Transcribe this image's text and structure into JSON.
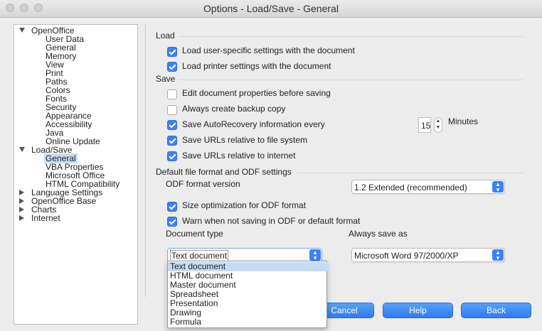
{
  "window": {
    "title": "Options - Load/Save - General"
  },
  "tree": {
    "items": [
      {
        "label": "OpenOffice",
        "level": 0,
        "expanded": true
      },
      {
        "label": "User Data",
        "level": 1
      },
      {
        "label": "General",
        "level": 1
      },
      {
        "label": "Memory",
        "level": 1
      },
      {
        "label": "View",
        "level": 1
      },
      {
        "label": "Print",
        "level": 1
      },
      {
        "label": "Paths",
        "level": 1
      },
      {
        "label": "Colors",
        "level": 1
      },
      {
        "label": "Fonts",
        "level": 1
      },
      {
        "label": "Security",
        "level": 1
      },
      {
        "label": "Appearance",
        "level": 1
      },
      {
        "label": "Accessibility",
        "level": 1
      },
      {
        "label": "Java",
        "level": 1
      },
      {
        "label": "Online Update",
        "level": 1
      },
      {
        "label": "Load/Save",
        "level": 0,
        "expanded": true
      },
      {
        "label": "General",
        "level": 1,
        "selected": true
      },
      {
        "label": "VBA Properties",
        "level": 1
      },
      {
        "label": "Microsoft Office",
        "level": 1
      },
      {
        "label": "HTML Compatibility",
        "level": 1
      },
      {
        "label": "Language Settings",
        "level": 0,
        "expanded": false
      },
      {
        "label": "OpenOffice Base",
        "level": 0,
        "expanded": false
      },
      {
        "label": "Charts",
        "level": 0,
        "expanded": false
      },
      {
        "label": "Internet",
        "level": 0,
        "expanded": false
      }
    ]
  },
  "load": {
    "heading": "Load",
    "user_settings": {
      "label": "Load user-specific settings with the document",
      "checked": true
    },
    "printer_settings": {
      "label": "Load printer settings with the document",
      "checked": true
    }
  },
  "save": {
    "heading": "Save",
    "edit_properties": {
      "label": "Edit document properties before saving",
      "checked": false
    },
    "backup_copy": {
      "label": "Always create backup copy",
      "checked": false
    },
    "autorecovery": {
      "label": "Save AutoRecovery information every",
      "checked": true,
      "value": "15",
      "unit": "Minutes"
    },
    "urls_fs": {
      "label": "Save URLs relative to file system",
      "checked": true
    },
    "urls_internet": {
      "label": "Save URLs relative to internet",
      "checked": true
    }
  },
  "odf": {
    "heading": "Default file format and ODF settings",
    "version_label": "ODF format version",
    "version_value": "1.2 Extended (recommended)",
    "size_opt": {
      "label": "Size optimization for ODF format",
      "checked": true
    },
    "warn": {
      "label": "Warn when not saving in ODF or default format",
      "checked": true
    },
    "doc_type_label": "Document type",
    "doc_type_value": "Text document",
    "save_as_label": "Always save as",
    "save_as_value": "Microsoft Word 97/2000/XP",
    "doc_type_options": [
      "Text document",
      "HTML document",
      "Master document",
      "Spreadsheet",
      "Presentation",
      "Drawing",
      "Formula"
    ]
  },
  "buttons": {
    "cancel": "Cancel",
    "help": "Help",
    "back": "Back"
  },
  "colors": {
    "accent": "#3b82f6",
    "selection": "#c6dcf5"
  }
}
